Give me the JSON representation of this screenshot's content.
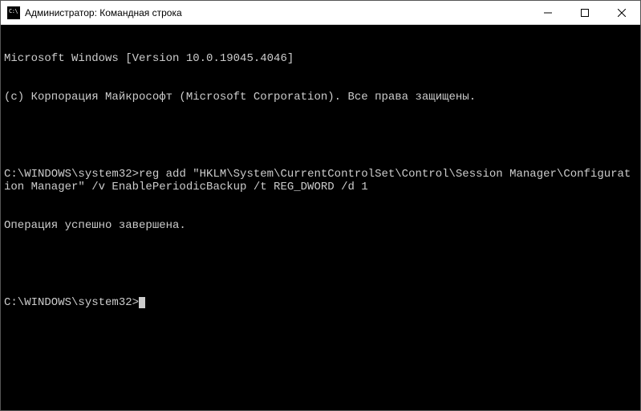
{
  "window": {
    "title": "Администратор: Командная строка"
  },
  "terminal": {
    "line1": "Microsoft Windows [Version 10.0.19045.4046]",
    "line2": "(с) Корпорация Майкрософт (Microsoft Corporation). Все права защищены.",
    "blank1": " ",
    "prompt1": "C:\\WINDOWS\\system32>",
    "cmd1": "reg add \"HKLM\\System\\CurrentControlSet\\Control\\Session Manager\\Configuration Manager\" /v EnablePeriodicBackup /t REG_DWORD /d 1",
    "result1": "Операция успешно завершена.",
    "blank2": " ",
    "prompt2": "C:\\WINDOWS\\system32>"
  }
}
